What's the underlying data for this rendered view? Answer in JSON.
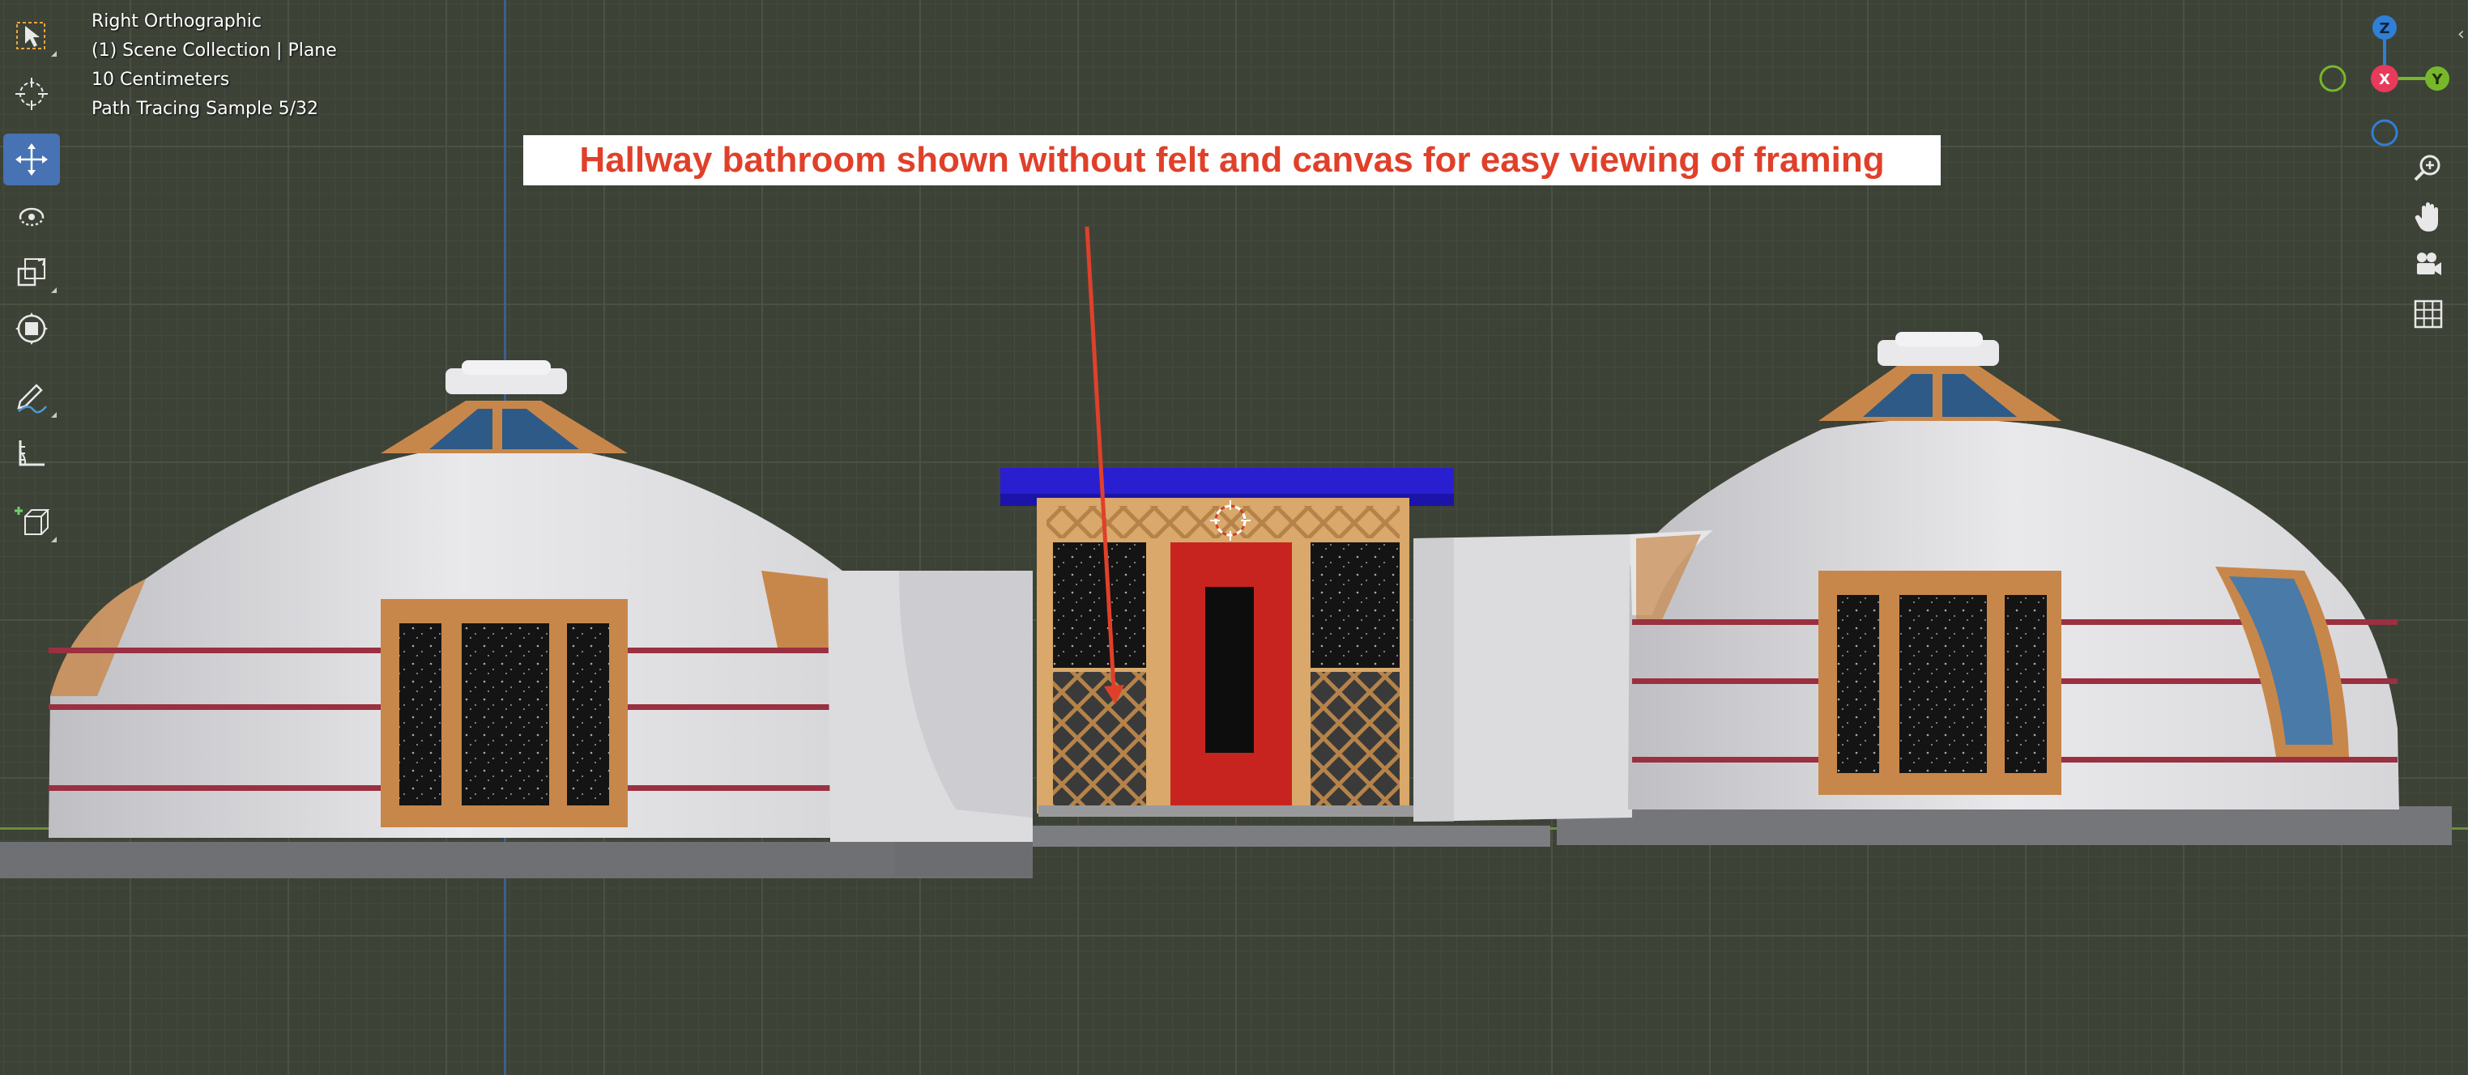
{
  "viewport": {
    "view_name": "Right Orthographic",
    "collection": "(1) Scene Collection | Plane",
    "grid_scale": "10 Centimeters",
    "render_status": "Path Tracing Sample 5/32"
  },
  "annotation": {
    "text": "Hallway bathroom shown without felt and canvas for easy viewing of framing",
    "color": "#e0402a"
  },
  "toolbar": {
    "active_tool": "move",
    "tools": [
      {
        "icon": "select-box-icon"
      },
      {
        "icon": "cursor-icon"
      },
      {
        "icon": "move-icon"
      },
      {
        "icon": "rotate-icon"
      },
      {
        "icon": "scale-icon"
      },
      {
        "icon": "transform-icon"
      },
      {
        "icon": "annotate-icon"
      },
      {
        "icon": "measure-icon"
      },
      {
        "icon": "add-cube-icon"
      }
    ]
  },
  "gizmo": {
    "z_label": "Z",
    "x_label": "X",
    "y_label": "Y",
    "colors": {
      "x": "#e83a5a",
      "y": "#76b82a",
      "z": "#2f7fd6"
    }
  },
  "nav_buttons": [
    {
      "icon": "zoom-icon"
    },
    {
      "icon": "pan-hand-icon"
    },
    {
      "icon": "camera-icon"
    },
    {
      "icon": "grid-view-icon"
    }
  ],
  "colors": {
    "active_tool_bg": "#4772b3",
    "grid_bg": "#3d4237",
    "door": "#c8241f",
    "roof_wall": "#e8e8ea",
    "wood": "#c8874a",
    "window_glass": "#3a5f8a",
    "hall_roof": "#2a1fd0"
  }
}
